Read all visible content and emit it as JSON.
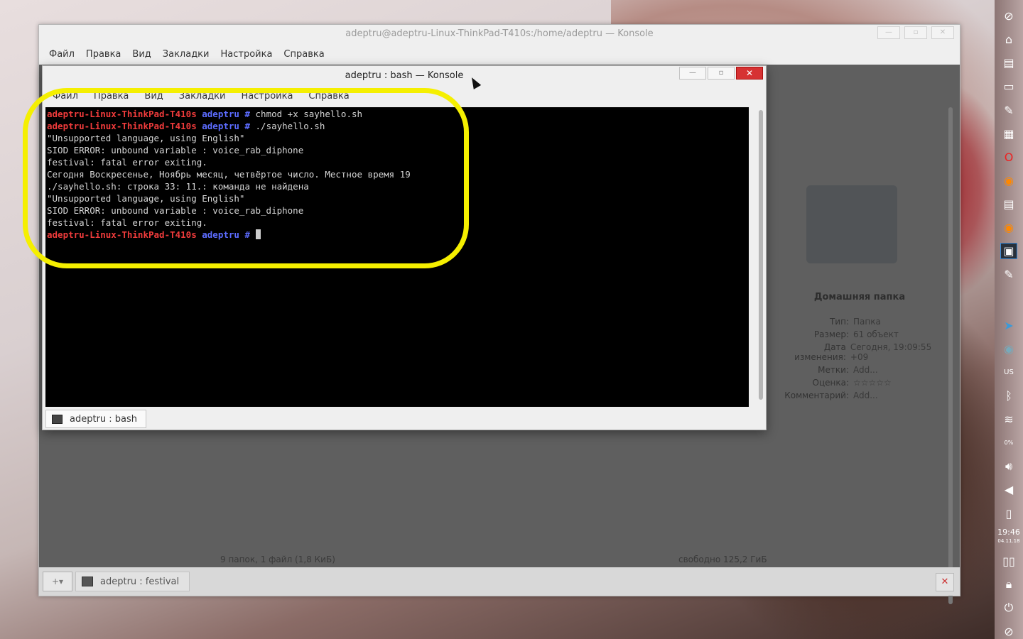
{
  "outer_window": {
    "title": "adeptru@adeptru-Linux-ThinkPad-T410s:/home/adeptru — Konsole",
    "menu": [
      "Файл",
      "Правка",
      "Вид",
      "Закладки",
      "Настройка",
      "Справка"
    ],
    "tab_label": "adeptru : festival",
    "file_info": {
      "title": "Домашняя папка",
      "rows": [
        {
          "k": "Тип:",
          "v": "Папка"
        },
        {
          "k": "Размер:",
          "v": "61 объект"
        },
        {
          "k": "Дата изменения:",
          "v": "Сегодня, 19:09:55 +09"
        },
        {
          "k": "Метки:",
          "v": "Add..."
        },
        {
          "k": "Оценка:",
          "v": "☆☆☆☆☆"
        },
        {
          "k": "Комментарий:",
          "v": "Add..."
        }
      ],
      "status": "9 папок, 1 файл (1,8 КиБ)",
      "free": "свободно 125,2 ГиБ"
    }
  },
  "inner_window": {
    "title": "adeptru : bash — Konsole",
    "menu": [
      "Файл",
      "Правка",
      "Вид",
      "Закладки",
      "Настройка",
      "Справка"
    ],
    "tab_label": "adeptru : bash",
    "prompt_host": "adeptru-Linux-ThinkPad-T410s",
    "prompt_dir": "adeptru #",
    "terminal": {
      "cmd1": "chmod +x sayhello.sh",
      "cmd2": "./sayhello.sh",
      "out": [
        "\"Unsupported language, using English\"",
        "SIOD ERROR: unbound variable : voice_rab_diphone",
        "festival: fatal error exiting.",
        "Сегодня Воскресенье, Ноябрь месяц, четвёртое число. Местное время 19",
        "./sayhello.sh: строка 33: 11.: команда не найдена",
        "\"Unsupported language, using English\"",
        "SIOD ERROR: unbound variable : voice_rab_diphone",
        "festival: fatal error exiting."
      ]
    }
  },
  "panel": {
    "time": "19:46",
    "date": "04.11.18",
    "battery": "0%"
  },
  "colors": {
    "highlight": "#f5ef00",
    "prompt_host": "#ef3b3b",
    "prompt_dir": "#5c6cff"
  }
}
